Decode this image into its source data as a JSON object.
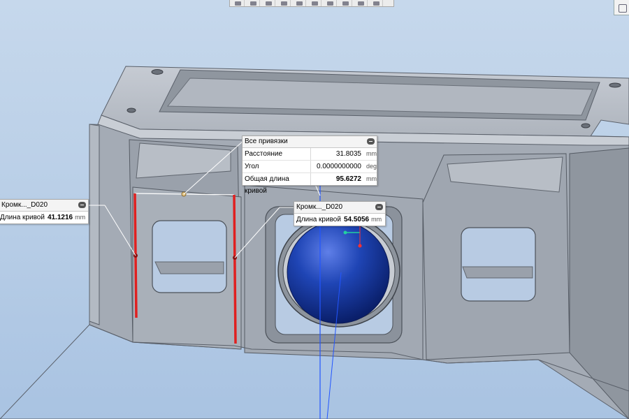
{
  "toolbar": {
    "buttons": [
      "zoom-window-icon",
      "zoom-in-icon",
      "zoom-out-icon",
      "pan-icon",
      "rotate-icon",
      "view-orient-icon",
      "display-style-icon",
      "snap-icon",
      "visibility-icon",
      "filter-icon"
    ]
  },
  "measure_main": {
    "title": "Все привязки",
    "rows": [
      {
        "label": "Расстояние",
        "value": "31.8035",
        "unit": "mm"
      },
      {
        "label": "Угол",
        "value": "0.0000000000",
        "unit": "deg"
      },
      {
        "label": "Общая длина кривой",
        "value": "95.6272",
        "unit": "mm"
      }
    ]
  },
  "measure_left": {
    "title": "Кромк..._D020",
    "rows": [
      {
        "label": "Длина кривой",
        "value": "41.1216",
        "unit": "mm"
      }
    ]
  },
  "measure_center": {
    "title": "Кромк..._D020",
    "rows": [
      {
        "label": "Длина кривой",
        "value": "54.5056",
        "unit": "mm"
      }
    ]
  },
  "colors": {
    "background": "#b9cfe7",
    "part": "#aab1bb",
    "highlight_edge": "#e02020",
    "sphere": "#1b3fa8",
    "axis": "#2255ff"
  }
}
